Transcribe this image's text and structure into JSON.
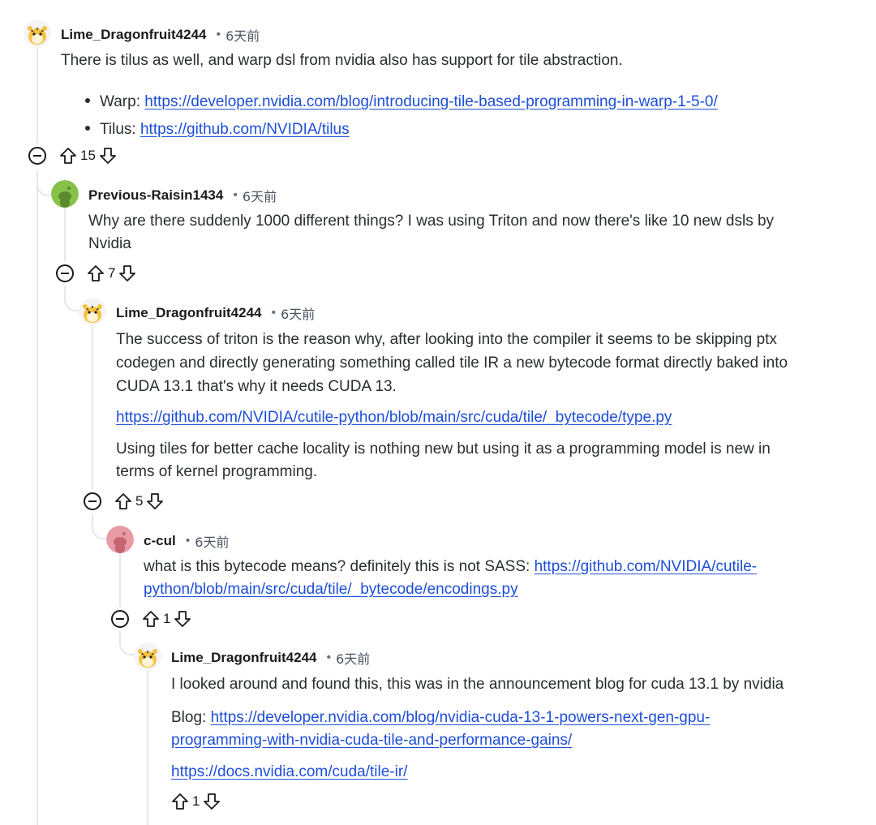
{
  "comments": [
    {
      "username": "Lime_Dragonfruit4244",
      "time": "6天前",
      "avatar": "tiger-avatar",
      "text": "There is tilus as well, and warp dsl from nvidia also has support for tile abstraction.",
      "bullets": [
        {
          "prefix": "Warp: ",
          "link": "https://developer.nvidia.com/blog/introducing-tile-based-programming-in-warp-1-5-0/"
        },
        {
          "prefix": "Tilus: ",
          "link": "https://github.com/NVIDIA/tilus"
        }
      ],
      "score": "15"
    },
    {
      "username": "Previous-Raisin1434",
      "time": "6天前",
      "avatar": "snoo-green-avatar",
      "lines": [
        "Why are there suddenly 1000 different things? I was using Triton and now there's like 10 new dsls by",
        "Nvidia"
      ],
      "score": "7"
    },
    {
      "username": "Lime_Dragonfruit4244",
      "time": "6天前",
      "avatar": "tiger-avatar",
      "lines": [
        "The success of triton is the reason why, after looking into the compiler it seems to be skipping ptx",
        "codegen and directly generating something called tile IR a new bytecode format directly baked into",
        "CUDA 13.1 that's why it needs CUDA 13."
      ],
      "link": "https://github.com/NVIDIA/cutile-python/blob/main/src/cuda/tile/_bytecode/type.py",
      "lines2": [
        "Using tiles for better cache locality is nothing new but using it as a programming model is new in",
        "terms of kernel programming."
      ],
      "score": "5"
    },
    {
      "username": "c-cul",
      "time": "6天前",
      "avatar": "snoo-pink-avatar",
      "text_prefix": "what is this bytecode means? definitely this is not SASS: ",
      "link_part1": "https://github.com/NVIDIA/cutile-",
      "link_part2": "python/blob/main/src/cuda/tile/_bytecode/encodings.py",
      "score": "1"
    },
    {
      "username": "Lime_Dragonfruit4244",
      "time": "6天前",
      "avatar": "tiger-avatar",
      "text": "I looked around and found this, this was in the announcement blog for cuda 13.1 by nvidia",
      "blog_prefix": "Blog: ",
      "blog_link1": "https://developer.nvidia.com/blog/nvidia-cuda-13-1-powers-next-gen-gpu-",
      "blog_link2": "programming-with-nvidia-cuda-tile-and-performance-gains/",
      "link": "https://docs.nvidia.com/cuda/tile-ir/",
      "score": "1"
    }
  ],
  "colors": {
    "link": "#1d4ed8",
    "thread_line": "#e5e7eb",
    "avatar_green": "#86c24a",
    "avatar_pink": "#e89aa5"
  }
}
